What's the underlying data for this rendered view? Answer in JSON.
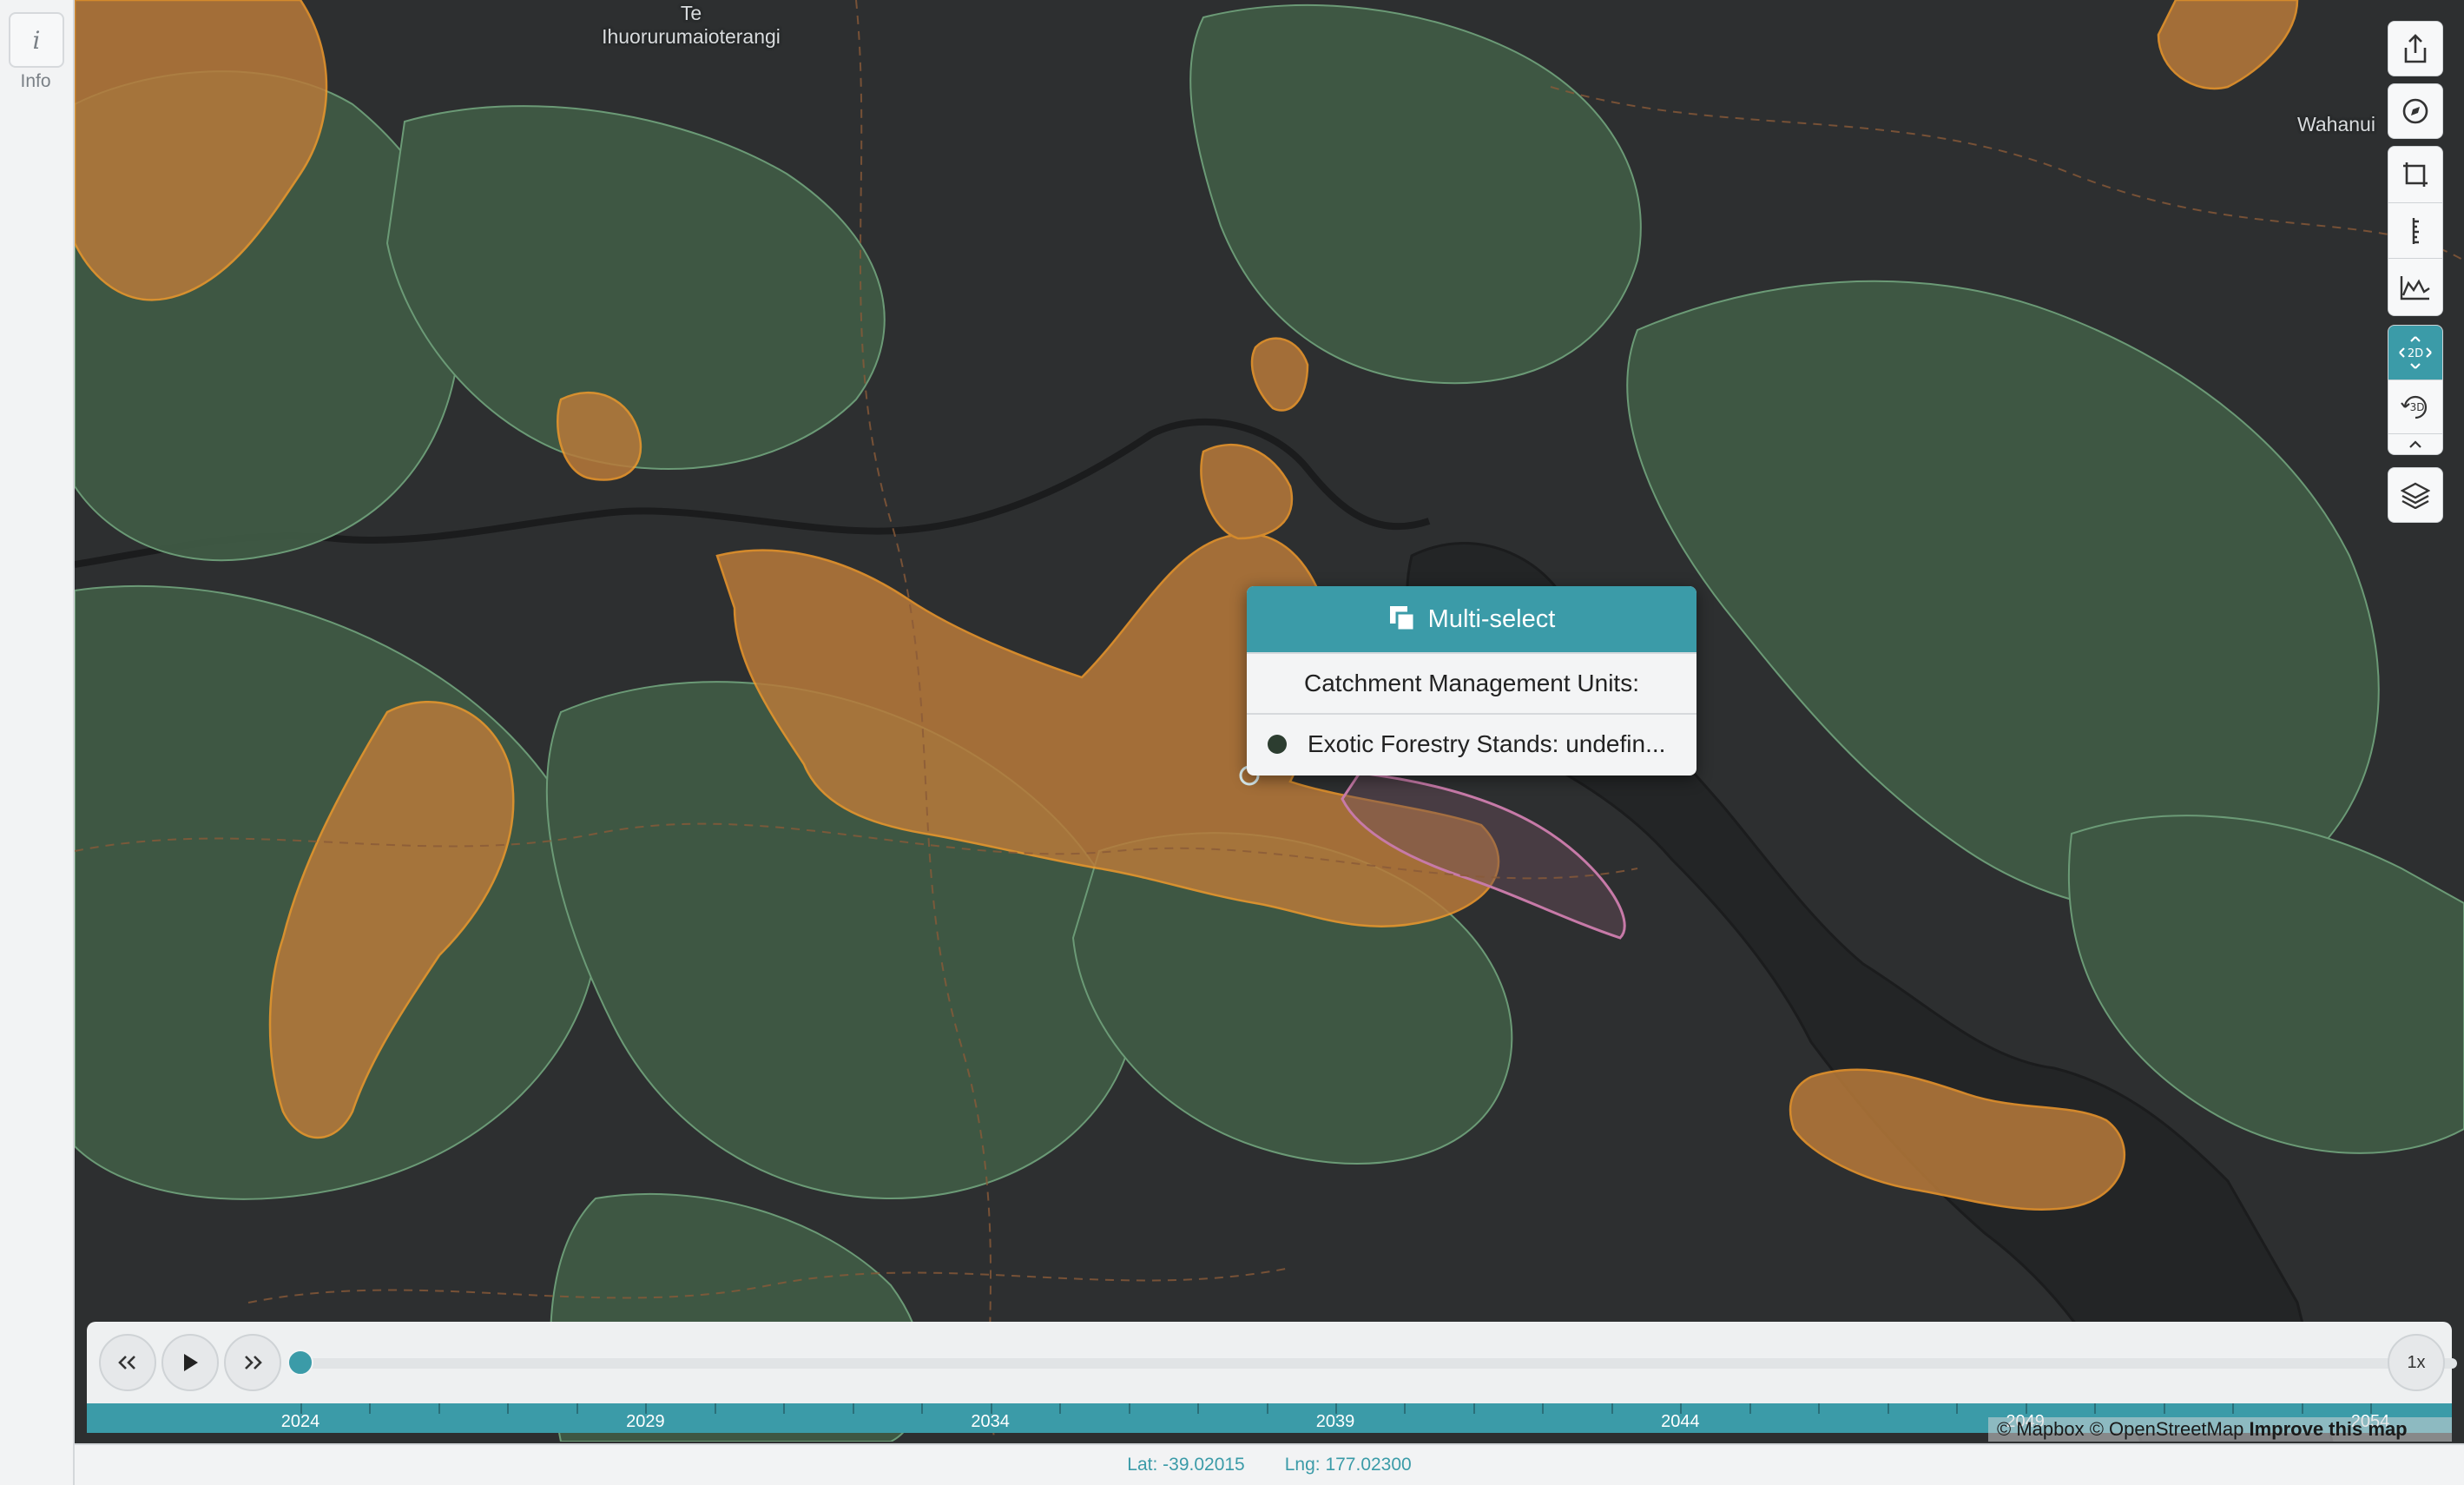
{
  "sidebar": {
    "info_icon": "info-icon",
    "info_label": "Info"
  },
  "map": {
    "places": [
      {
        "name": "Te\nIhuorurumaioterangi"
      },
      {
        "name": "Wahanui"
      }
    ],
    "colors": {
      "background": "#2d2f30",
      "forest": "#3f5a45",
      "forest_outline": "#6fa07a",
      "exotic_forestry": "#b87a3a",
      "exotic_outline": "#f29a2c",
      "catchment_outline": "#c77aa8",
      "lake": "#232526",
      "roads": "#8a5a38"
    }
  },
  "map_controls": [
    {
      "name": "share-icon"
    },
    {
      "name": "compass-icon"
    },
    {
      "name": "crop-icon"
    },
    {
      "name": "ruler-icon"
    },
    {
      "name": "elevation-profile-icon"
    },
    {
      "name": "2d-view-icon",
      "label": "2D",
      "active": true
    },
    {
      "name": "3d-rotate-icon",
      "label": "3D"
    },
    {
      "name": "layers-icon"
    }
  ],
  "popup": {
    "title": "Multi-select",
    "rows": [
      "Catchment Management Units:",
      "Exotic Forestry Stands: undefin..."
    ]
  },
  "timeline": {
    "speed_label": "1x",
    "current_year": 2024,
    "start_year": 2024,
    "end_year": 2054,
    "year_labels": [
      "2024",
      "2029",
      "2034",
      "2039",
      "2044",
      "2049",
      "2054"
    ]
  },
  "attribution": {
    "text": "© Mapbox © OpenStreetMap",
    "link": "Improve this map"
  },
  "status": {
    "lat": "Lat: -39.02015",
    "lng": "Lng: 177.02300"
  }
}
